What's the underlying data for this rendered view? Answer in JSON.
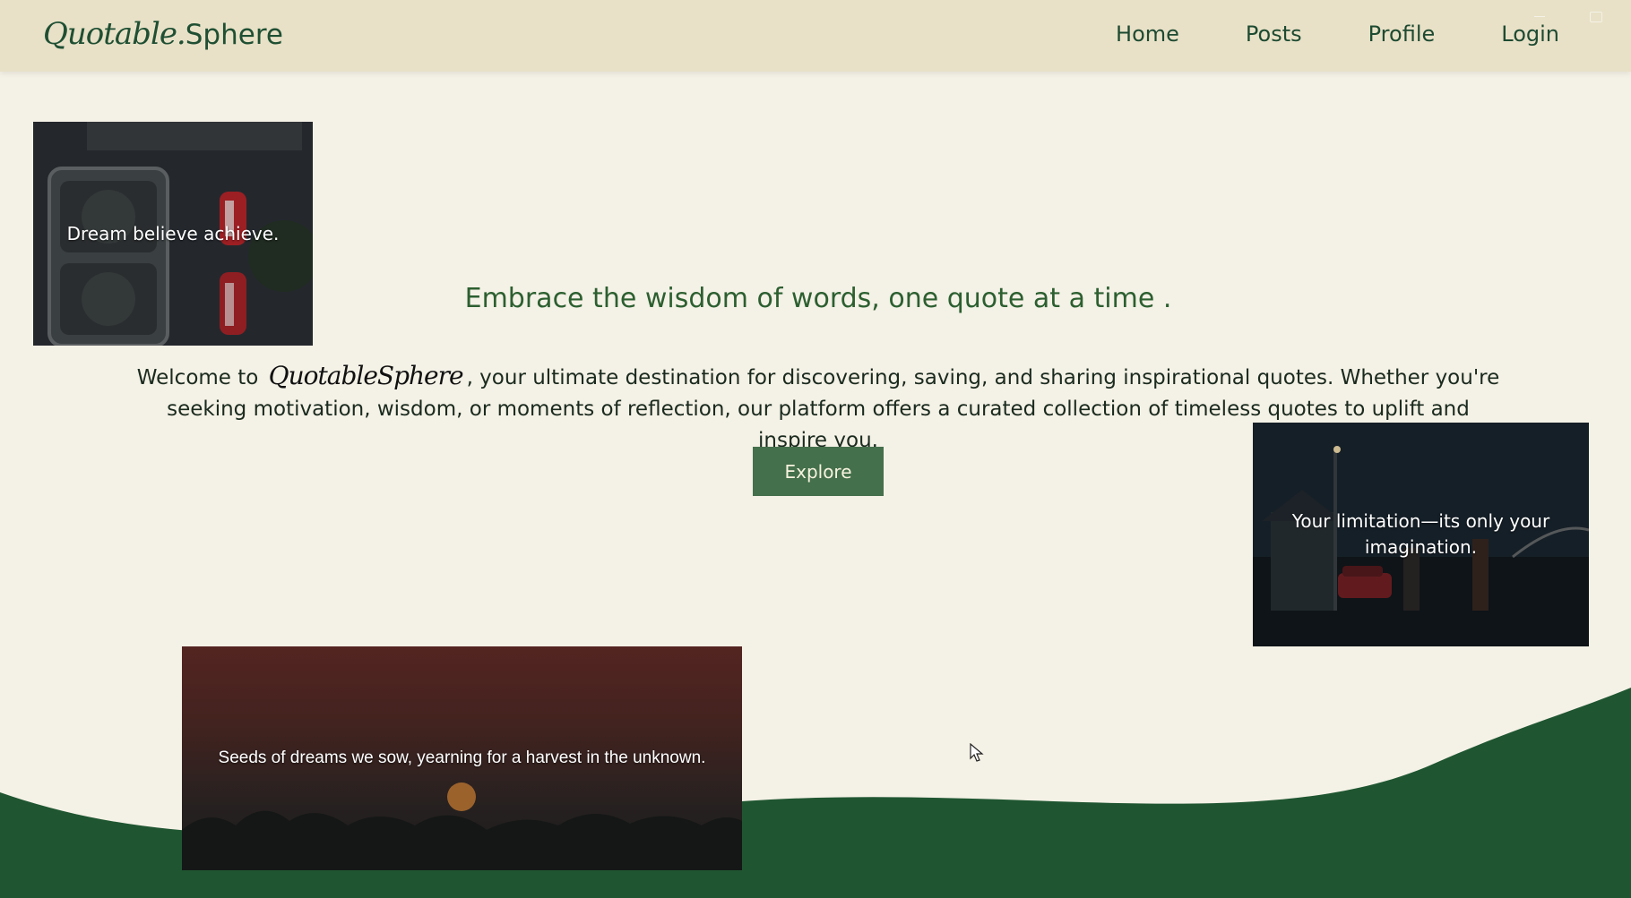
{
  "header": {
    "brand_script": "Quotable.",
    "brand_sans": "Sphere",
    "nav": [
      "Home",
      "Posts",
      "Profile",
      "Login"
    ]
  },
  "hero": {
    "title": "Embrace the wisdom of words, one quote at a time .",
    "body_before": "Welcome to",
    "body_brand": "QuotableSphere",
    "body_after": ", your ultimate destination for discovering, saving, and sharing inspirational quotes. Whether you're seeking motivation, wisdom, or moments of reflection, our platform offers a curated collection of timeless quotes to uplift and inspire you.",
    "button": "Explore"
  },
  "cards": [
    {
      "text": "Dream believe achieve."
    },
    {
      "text": "Your limitation—its only your imagination."
    },
    {
      "text": "Seeds of dreams we sow, yearning for a harvest in the unknown."
    }
  ],
  "colors": {
    "background": "#f4f1e6",
    "header": "#e8e1c7",
    "brand": "#1f4f33",
    "accent_button": "#44704b",
    "wave": "#1f5631"
  },
  "icons": [
    "window-minimize-icon",
    "window-maximize-icon",
    "mouse-pointer-icon"
  ]
}
